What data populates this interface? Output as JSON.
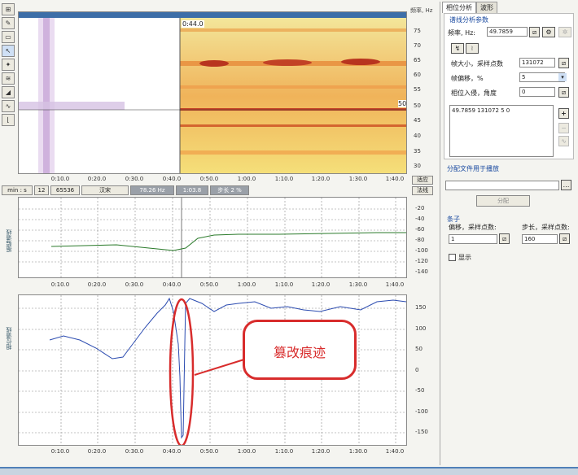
{
  "toolbar": {
    "tools": [
      "select-icon",
      "pencil-icon",
      "rect-icon",
      "cursor-icon",
      "marker-icon",
      "wave-icon",
      "zoom-icon",
      "curve-icon",
      "reset-icon"
    ]
  },
  "spectrogram": {
    "freq_title": "频率, Hz",
    "freq_ticks": [
      "75",
      "70",
      "65",
      "60",
      "55",
      "50",
      "45",
      "40",
      "35",
      "30"
    ],
    "marker_time": "0:44.0",
    "marker_freq": "50"
  },
  "time_axis": [
    "0:10.0",
    "0:20.0",
    "0:30.0",
    "0:40.0",
    "0:50.0",
    "1:00.0",
    "1:10.0",
    "1:20.0",
    "1:30.0",
    "1:40.0"
  ],
  "status": {
    "unit": "min : s",
    "v1": "12",
    "v2": "65536",
    "v3": "汉宋",
    "freq": "78.26 Hz",
    "time": "1:03.8",
    "step": "步长 2 %"
  },
  "side_buttons": {
    "fit": "适应",
    "more": "法线"
  },
  "amp_plot": {
    "label": "振幅谱线",
    "ticks": [
      "-20",
      "-40",
      "-60",
      "-80",
      "-100",
      "-120",
      "-140"
    ]
  },
  "phase_plot": {
    "label": "相位谱线",
    "ticks": [
      "150",
      "100",
      "50",
      "0",
      "-50",
      "-100",
      "-150"
    ]
  },
  "annotation": {
    "text": "篡改痕迹"
  },
  "colors": {
    "annotation": "#d82c2c",
    "amp_curve": "#2a7a2a",
    "phase_curve": "#2b4bb0"
  },
  "panel": {
    "tabs": [
      "相位分析",
      "波形"
    ],
    "group_title": "谱线分析参数",
    "freq_label": "频率, Hz:",
    "freq_value": "49.7859",
    "frame_label": "帧大小，采样点数",
    "frame_value": "131072",
    "offset_label": "帧偏移，%",
    "offset_value": "5",
    "phase_label": "相位入侵，角度",
    "phase_value": "0",
    "list_item": "49.7859 131072 5 0",
    "assign_title": "分配文件用于播放",
    "assign_button": "分配",
    "strip_title": "条子",
    "offset_samples_label": "偏移，采样点数:",
    "offset_samples_value": "1",
    "step_samples_label": "步长，采样点数:",
    "step_samples_value": "160",
    "show_label": "显示"
  }
}
